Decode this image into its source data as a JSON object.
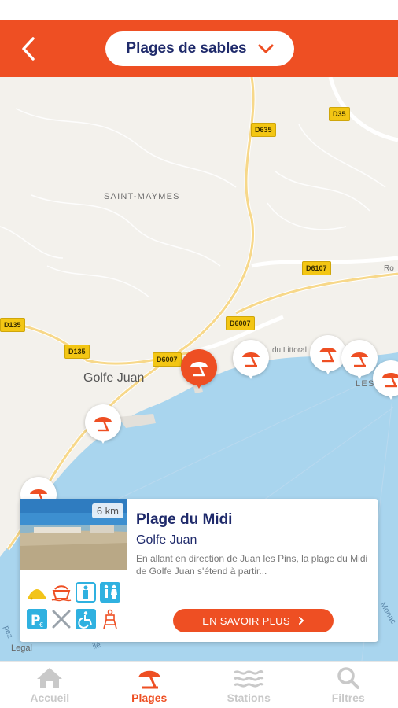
{
  "header": {
    "back_icon": "chevron-left-icon",
    "selector_label": "Plages de sables",
    "selector_icon": "chevron-down-icon"
  },
  "map": {
    "road_labels": [
      "D635",
      "D35",
      "D6107",
      "D135",
      "D135",
      "D6007",
      "D6007"
    ],
    "place_label": "SAINT-MAYMES",
    "town_label": "Golfe Juan",
    "street_label": "du Littoral",
    "edge_labels": [
      "Ro",
      "LES",
      "Monac",
      "pez",
      "ilé"
    ],
    "legal_label": "Legal"
  },
  "card": {
    "distance": "6 km",
    "title": "Plage du Midi",
    "subtitle": "Golfe Juan",
    "description": "En allant en direction de Juan les Pins, la plage du Midi de Golfe Juan s'étend à partir...",
    "amenities": [
      "sand-icon",
      "boat-icon",
      "shower-icon",
      "toilets-icon",
      "parking-icon",
      "restaurant-icon",
      "accessibility-icon",
      "lifeguard-icon"
    ],
    "cta_label": "EN SAVOIR PLUS",
    "cta_icon": "chevron-right-icon"
  },
  "tabs": [
    {
      "label": "Accueil",
      "icon": "home-icon",
      "active": false
    },
    {
      "label": "Plages",
      "icon": "beach-umbrella-icon",
      "active": true
    },
    {
      "label": "Stations",
      "icon": "waves-icon",
      "active": false
    },
    {
      "label": "Filtres",
      "icon": "search-icon",
      "active": false
    }
  ],
  "colors": {
    "accent": "#ee4f23",
    "navy": "#1f2a6b",
    "water": "#a9d5ee",
    "road_yellow": "#f3c614"
  }
}
